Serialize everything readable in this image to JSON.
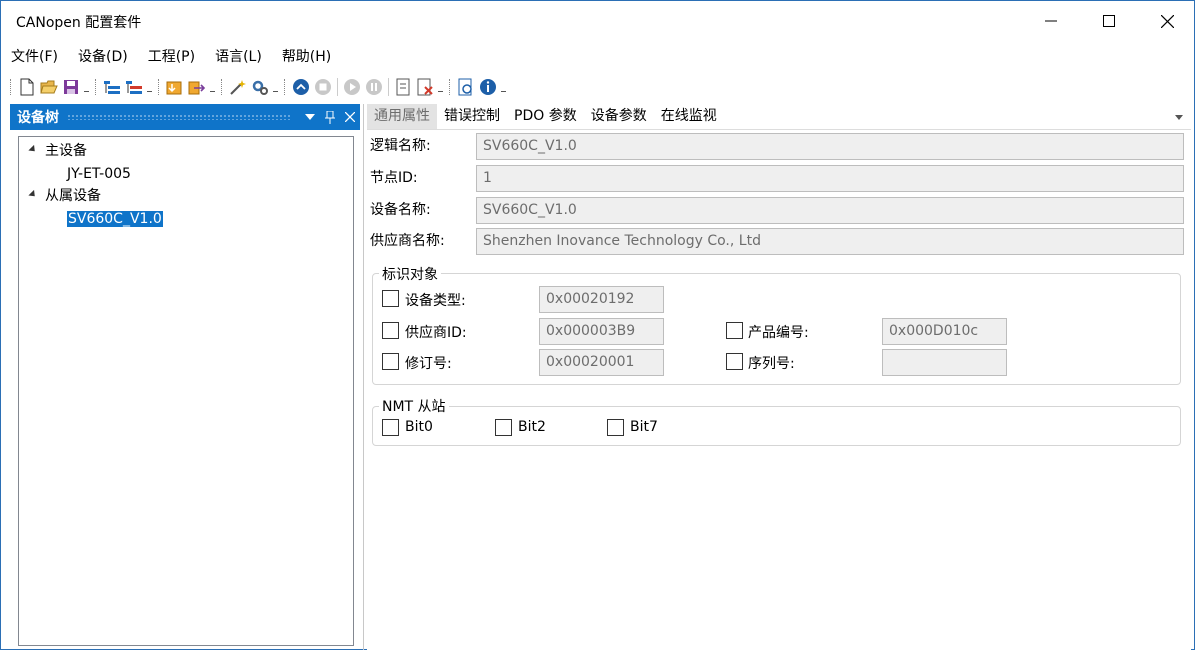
{
  "window": {
    "title": "CANopen 配置套件"
  },
  "menu": [
    "文件(F)",
    "设备(D)",
    "工程(P)",
    "语言(L)",
    "帮助(H)"
  ],
  "device_tree": {
    "title": "设备树",
    "nodes": [
      {
        "label": "主设备"
      },
      {
        "label": "JY-ET-005"
      },
      {
        "label": "从属设备"
      },
      {
        "label": "SV660C_V1.0"
      }
    ]
  },
  "tabs": [
    "通用属性",
    "错误控制",
    "PDO 参数",
    "设备参数",
    "在线监视"
  ],
  "general": {
    "logical_name_label": "逻辑名称:",
    "logical_name": "SV660C_V1.0",
    "node_id_label": "节点ID:",
    "node_id": "1",
    "device_name_label": "设备名称:",
    "device_name": "SV660C_V1.0",
    "vendor_name_label": "供应商名称:",
    "vendor_name": "Shenzhen Inovance Technology Co., Ltd"
  },
  "identity": {
    "title": "标识对象",
    "device_type_label": "设备类型:",
    "device_type": "0x00020192",
    "vendor_id_label": "供应商ID:",
    "vendor_id": "0x000003B9",
    "revision_label": "修订号:",
    "revision": "0x00020001",
    "product_code_label": "产品编号:",
    "product_code": "0x000D010c",
    "serial_label": "序列号:",
    "serial": ""
  },
  "nmt": {
    "title": "NMT 从站",
    "bits": [
      "Bit0",
      "Bit2",
      "Bit7"
    ]
  },
  "colors": {
    "accent": "#0f74c9",
    "field_bg": "#efefef"
  }
}
